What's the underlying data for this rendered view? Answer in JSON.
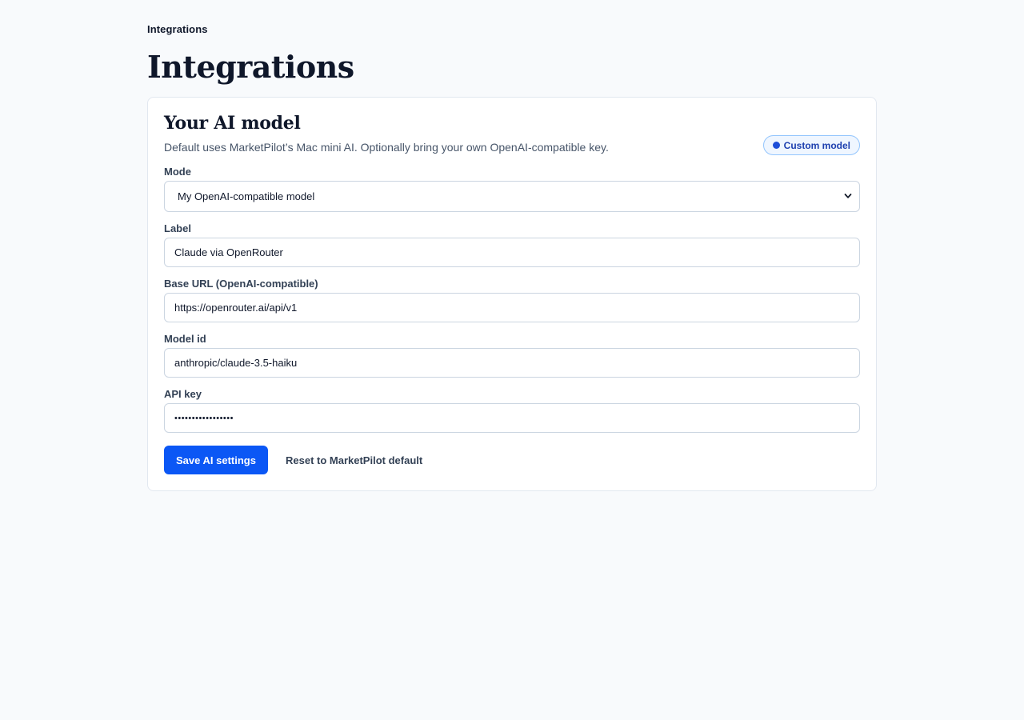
{
  "breadcrumb": "Integrations",
  "page_title": "Integrations",
  "card": {
    "title": "Your AI model",
    "description": "Default uses MarketPilot’s Mac mini AI. Optionally bring your own OpenAI-compatible key.",
    "badge": {
      "label": "Custom model",
      "icon": "dot-icon",
      "color": "#1d4ed8"
    }
  },
  "form": {
    "mode": {
      "label": "Mode",
      "selected": "My OpenAI-compatible model"
    },
    "label_field": {
      "label": "Label",
      "value": "Claude via OpenRouter"
    },
    "base_url": {
      "label": "Base URL (OpenAI-compatible)",
      "value": "https://openrouter.ai/api/v1"
    },
    "model_id": {
      "label": "Model id",
      "value": "anthropic/claude-3.5-haiku"
    },
    "api_key": {
      "label": "API key",
      "value": "•••••••••••••••••"
    }
  },
  "actions": {
    "save_label": "Save AI settings",
    "reset_label": "Reset to MarketPilot default"
  },
  "colors": {
    "primary": "#0b57f5",
    "background": "#f8fafc",
    "badge_border": "#93c5fd"
  }
}
